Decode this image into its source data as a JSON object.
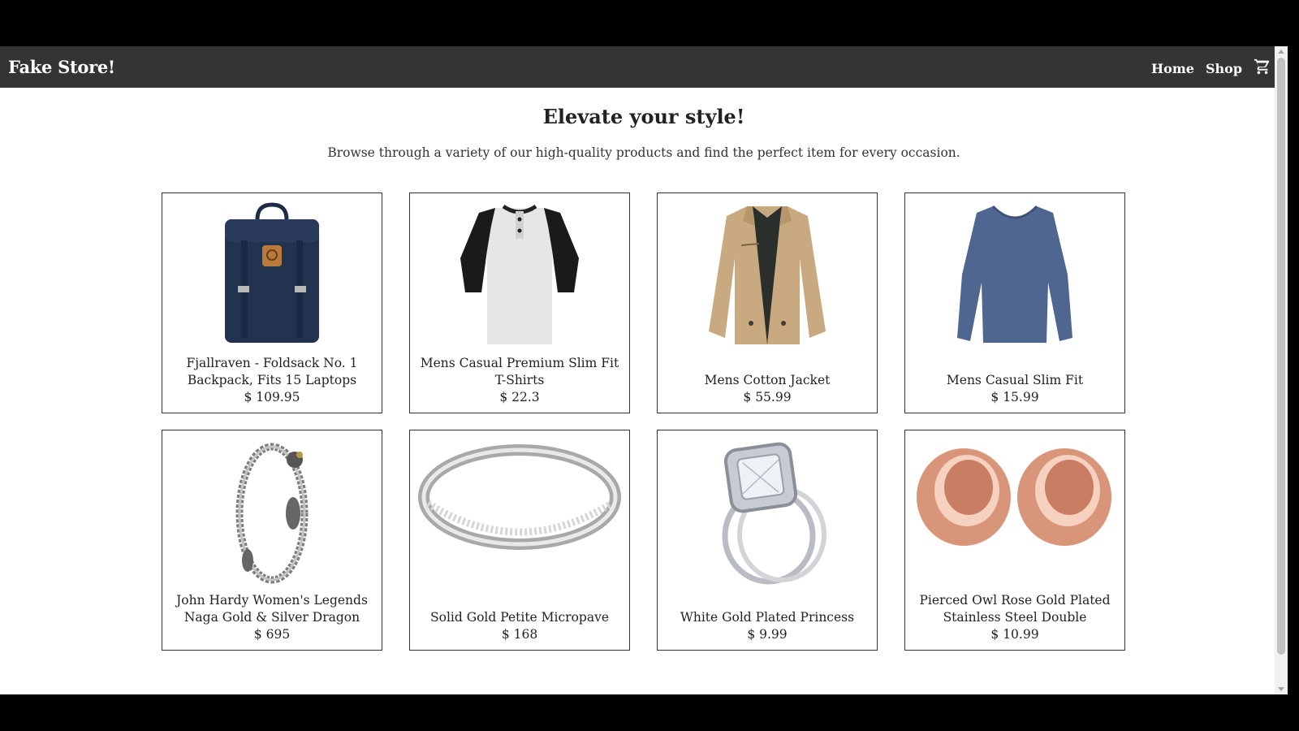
{
  "navbar": {
    "brand": "Fake Store!",
    "links": [
      "Home",
      "Shop"
    ],
    "cart_icon": "cart-icon"
  },
  "hero": {
    "title": "Elevate your style!",
    "subtitle": "Browse through a variety of our high-quality products and find the perfect item for every occasion."
  },
  "products": [
    {
      "title": "Fjallraven - Foldsack No. 1 Backpack, Fits 15 Laptops",
      "price": "$ 109.95",
      "icon": "backpack-image"
    },
    {
      "title": "Mens Casual Premium Slim Fit T-Shirts",
      "price": "$ 22.3",
      "icon": "tshirt-image"
    },
    {
      "title": "Mens Cotton Jacket",
      "price": "$ 55.99",
      "icon": "jacket-image"
    },
    {
      "title": "Mens Casual Slim Fit",
      "price": "$ 15.99",
      "icon": "longsleeve-image"
    },
    {
      "title": "John Hardy Women's Legends Naga Gold & Silver Dragon Stati...",
      "price": "$ 695",
      "icon": "bracelet-image"
    },
    {
      "title": "Solid Gold Petite Micropave",
      "price": "$ 168",
      "icon": "ring-image"
    },
    {
      "title": "White Gold Plated Princess",
      "price": "$ 9.99",
      "icon": "diamond-ring-image"
    },
    {
      "title": "Pierced Owl Rose Gold Plated Stainless Steel Double",
      "price": "$ 10.99",
      "icon": "ear-plugs-image"
    }
  ],
  "colors": {
    "navbar_bg": "#343434",
    "backpack": "#23324f",
    "jacket": "#c9a97f",
    "longsleeve": "#4f6790",
    "rosegold": "#d9957a"
  }
}
